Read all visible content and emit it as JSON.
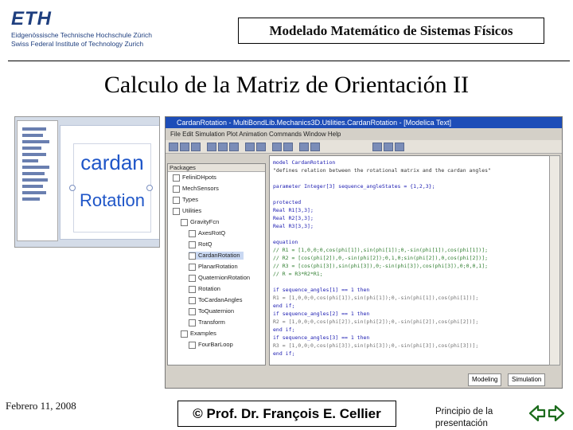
{
  "header": {
    "logo_text": "ETH",
    "institution_de": "Eidgenössische Technische Hochschule Zürich",
    "institution_en": "Swiss Federal Institute of Technology Zurich",
    "course_title": "Modelado Matemático de Sistemas Físicos"
  },
  "slide": {
    "title": "Calculo de la Matriz de Orientación II"
  },
  "screenshot": {
    "icon_label_1": "cardan",
    "icon_label_2": "Rotation",
    "editor_title": "CardanRotation - MultiBondLib.Mechanics3D.Utilities.CardanRotation - [Modelica Text]",
    "menu_text": "File  Edit  Simulation  Plot  Animation  Commands  Window  Help",
    "browser_header": "Packages",
    "package_items": [
      "FeliniDHpots",
      "MechSensors",
      "Types",
      "Utilities",
      "GravityFcn",
      "AxesRotQ",
      "RotQ",
      "CardanRotation",
      "PlanarRotation",
      "QuaternionRotation",
      "Rotation",
      "ToCardanAngles",
      "ToQuaternion",
      "Transform",
      "Examples",
      "FourBarLoop"
    ],
    "code_lines": [
      "model CardanRotation",
      "  \"defines relation between the rotational matrix and the cardan angles\"",
      "",
      "  parameter Integer[3] sequence_angleStates = {1,2,3};",
      "",
      "protected",
      "  Real R1[3,3];",
      "  Real R2[3,3];",
      "  Real R3[3,3];",
      "",
      "equation",
      "// R1 = [1,0,0;0,cos(phi[1]),sin(phi[1]);0,-sin(phi[1]),cos(phi[1])];",
      "// R2 = [cos(phi[2]),0,-sin(phi[2]);0,1,0;sin(phi[2]),0,cos(phi[2])];",
      "// R3 = [cos(phi[3]),sin(phi[3]),0;-sin(phi[3]),cos(phi[3]),0;0,0,1];",
      "// R = R3*R2*R1;",
      "",
      "  if sequence_angles[1] == 1 then",
      "    R1 = [1,0,0;0,cos(phi[1]),sin(phi[1]);0,-sin(phi[1]),cos(phi[1])];",
      "  end if;",
      "  if sequence_angles[2] == 1 then",
      "    R2 = [1,0,0;0,cos(phi[2]),sin(phi[2]);0,-sin(phi[2]),cos(phi[2])];",
      "  end if;",
      "  if sequence_angles[3] == 1 then",
      "    R3 = [1,0,0;0,cos(phi[3]),sin(phi[3]);0,-sin(phi[3]),cos(phi[3])];",
      "  end if;"
    ],
    "modeling_label": "Modeling",
    "simulation_label": "Simulation"
  },
  "footer": {
    "date": "Febrero 11, 2008",
    "author": "© Prof. Dr. François E. Cellier",
    "back_link": "Principio de la presentación"
  },
  "colors": {
    "eth_blue": "#1f3f7f",
    "cardan_blue": "#1f56c8",
    "editor_title_bar": "#1d4db8"
  },
  "icons": {
    "nav": "double-arrow-icon"
  }
}
